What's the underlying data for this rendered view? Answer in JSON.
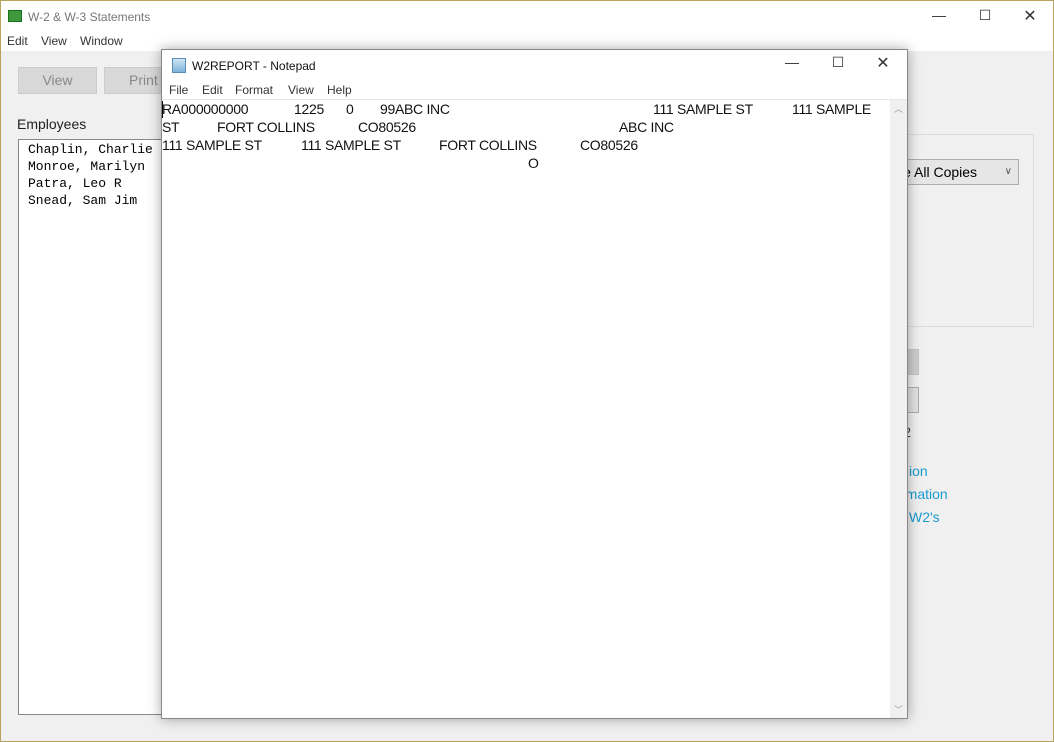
{
  "main_window": {
    "title": "W-2 & W-3 Statements",
    "menu": [
      "Edit",
      "View",
      "Window"
    ],
    "buttons": {
      "view": "View",
      "print": "Print"
    },
    "employees_label": "Employees",
    "employees": [
      "Chaplin, Charlie",
      "Monroe, Marilyn",
      "Patra, Leo R",
      "Snead, Sam Jim"
    ],
    "copies_select": "See All Copies",
    "partial_text": "2",
    "links": [
      "ion",
      "rmation",
      "W2's"
    ],
    "link_color": "#1a9bd0"
  },
  "notepad": {
    "title": "W2REPORT - Notepad",
    "menu": [
      "File",
      "Edit",
      "Format",
      "View",
      "Help"
    ],
    "lines": [
      [
        "RA000000000",
        "1225",
        "0",
        "99ABC INC",
        "111 SAMPLE ST",
        "111 SAMPLE"
      ],
      [
        "ST",
        "FORT COLLINS",
        "CO80526",
        "ABC INC"
      ],
      [
        "111 SAMPLE ST",
        "111 SAMPLE ST",
        "FORT COLLINS",
        "CO80526"
      ],
      [
        "O"
      ]
    ]
  }
}
